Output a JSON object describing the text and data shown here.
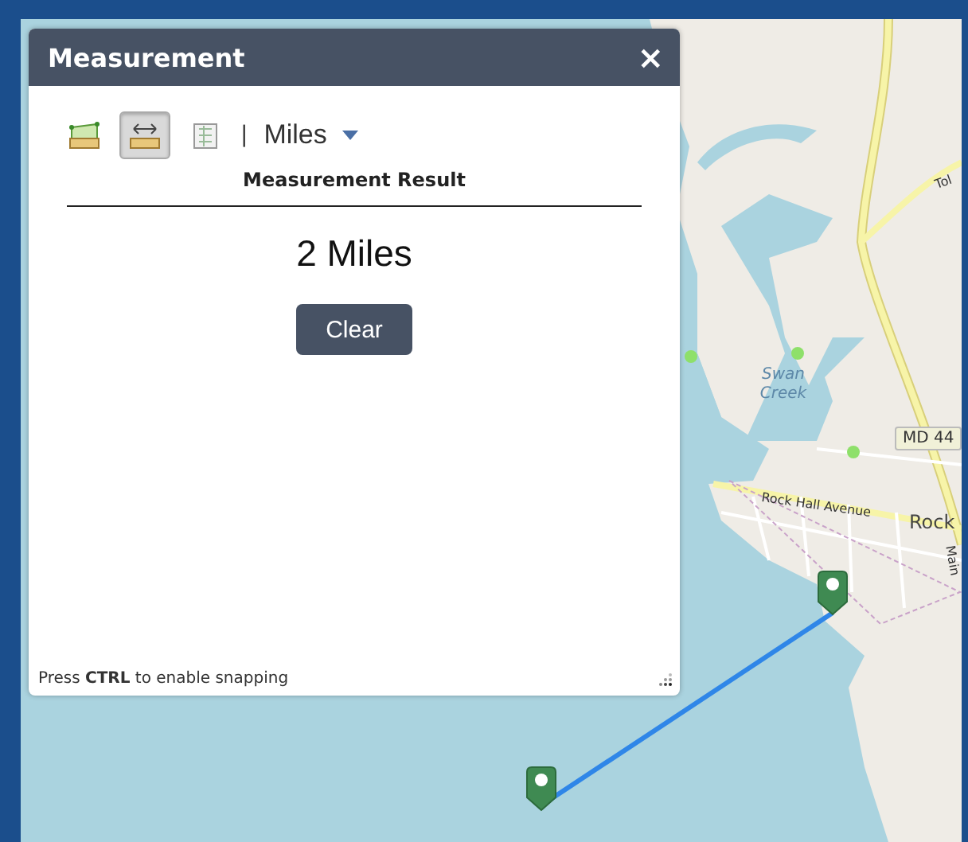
{
  "map": {
    "labels": [
      {
        "kind": "road",
        "text": "Tol"
      },
      {
        "kind": "water",
        "text": "Swan Creek"
      },
      {
        "kind": "shield",
        "text": "MD 44"
      },
      {
        "kind": "road",
        "text": "Rock Hall Avenue"
      },
      {
        "kind": "place",
        "text": "Rock"
      },
      {
        "kind": "road",
        "text": "Main"
      }
    ]
  },
  "panel": {
    "title": "Measurement",
    "close": "×",
    "tools": [
      {
        "kind": "area",
        "selected": false
      },
      {
        "kind": "distance",
        "selected": true
      },
      {
        "kind": "location",
        "selected": false
      }
    ],
    "separator": "|",
    "unit": "Miles",
    "result_heading": "Measurement Result",
    "result": "2 Miles",
    "clear_button": "Clear",
    "hint": "Press **CTRL** to enable snapping"
  }
}
